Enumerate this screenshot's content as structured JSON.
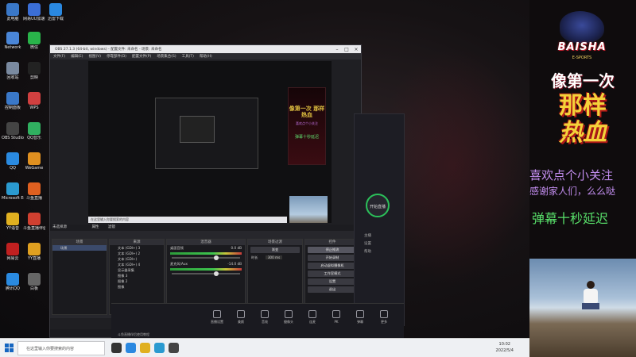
{
  "desktop_icons": [
    {
      "label": "此电脑",
      "color": "#3a78c8"
    },
    {
      "label": "网易UU加速器",
      "color": "#3b6ed6"
    },
    {
      "label": "迅雷下载",
      "color": "#2a88e0"
    },
    {
      "label": "Network",
      "color": "#4a86d8"
    },
    {
      "label": "微信",
      "color": "#29b34a"
    },
    {
      "label": "回收站",
      "color": "#7a8aa0"
    },
    {
      "label": "剪映",
      "color": "#222222"
    },
    {
      "label": "控制面板",
      "color": "#3a78c8"
    },
    {
      "label": "WPS",
      "color": "#d04040"
    },
    {
      "label": "OBS Studio",
      "color": "#444444"
    },
    {
      "label": "QQ音乐",
      "color": "#30b060"
    },
    {
      "label": "QQ",
      "color": "#2a8ae0"
    },
    {
      "label": "WeGame",
      "color": "#e09020"
    },
    {
      "label": "Microsoft Edge",
      "color": "#2a9ad0"
    },
    {
      "label": "斗鱼直播",
      "color": "#e06020"
    },
    {
      "label": "YY语音",
      "color": "#e0b020"
    },
    {
      "label": "斗鱼直播伴侣",
      "color": "#d04030"
    },
    {
      "label": "网易云",
      "color": "#c02020"
    },
    {
      "label": "YY直播",
      "color": "#e0a020"
    },
    {
      "label": "腾讯QQ",
      "color": "#2a8ae0"
    },
    {
      "label": "白板",
      "color": "#666666"
    }
  ],
  "obs": {
    "title": "OBS 27.1.3 (64-bit, windows) - 配置文件: 未命名 - 场景: 未命名",
    "menu": [
      "文件(F)",
      "编辑(E)",
      "视图(V)",
      "停靠部件(D)",
      "配置文件(P)",
      "场景集合(S)",
      "工具(T)",
      "帮助(H)"
    ],
    "preview_taskbar_text": "在这里输入你要搜索的内容",
    "preview_banner_line1": "像第一次 那样热血",
    "preview_banner_line2": "喜欢点个小关注",
    "preview_banner_line3": "弹幕十秒延迟",
    "dock_bar_label": "未选择源",
    "dock_bar_props": "属性",
    "dock_bar_filters": "滤镜",
    "docks": {
      "scenes_title": "场景",
      "scenes": [
        "场景"
      ],
      "sources_title": "来源",
      "sources": [
        "文本 (GDI+) 3",
        "文本 (GDI+) 2",
        "文本 (GDI+)",
        "文本 (GDI+) 4",
        "显示器采集",
        "图像 3",
        "图像 2",
        "图像"
      ],
      "mixer_title": "混音器",
      "mixer": [
        {
          "name": "桌面音频",
          "db": "0.0 dB"
        },
        {
          "name": "麦克风/Aux",
          "db": "-14.0 dB"
        }
      ],
      "transitions_title": "场景过渡",
      "transition_type": "渐变",
      "duration_label": "时长",
      "duration_value": "300 ms",
      "controls_title": "控件",
      "controls": [
        "停止推流",
        "开始录制",
        "启动虚拟摄像机",
        "工作室模式",
        "设置",
        "退出"
      ]
    },
    "status": {
      "live": "LIVE: 00:00:00",
      "rec": "REC: 00:00:00",
      "cpu": "CPU: 5.7%, 30.00 fps"
    }
  },
  "live_app": {
    "start_label": "开始直播",
    "side_items": [
      "主播",
      "设置",
      "帮助"
    ],
    "bottom_items": [
      "直播设置",
      "美颜",
      "音效",
      "摄像头",
      "连麦",
      "PK",
      "弹幕",
      "更多"
    ],
    "bottom_note": "斗鱼直播伴侣使用教程"
  },
  "overlay": {
    "logo_word": "BAISHA",
    "logo_sub": "E-SPORTS",
    "title_line1": "像第一次",
    "title_line2": "那样",
    "title_line3": "热血",
    "line1": "喜欢点个小关注",
    "line2": "感谢家人们，么么哒",
    "line3": "弹幕十秒延迟"
  },
  "taskbar": {
    "search_placeholder": "在这里输入你要搜索的内容",
    "time": "10:02",
    "date": "2022/5/4"
  }
}
